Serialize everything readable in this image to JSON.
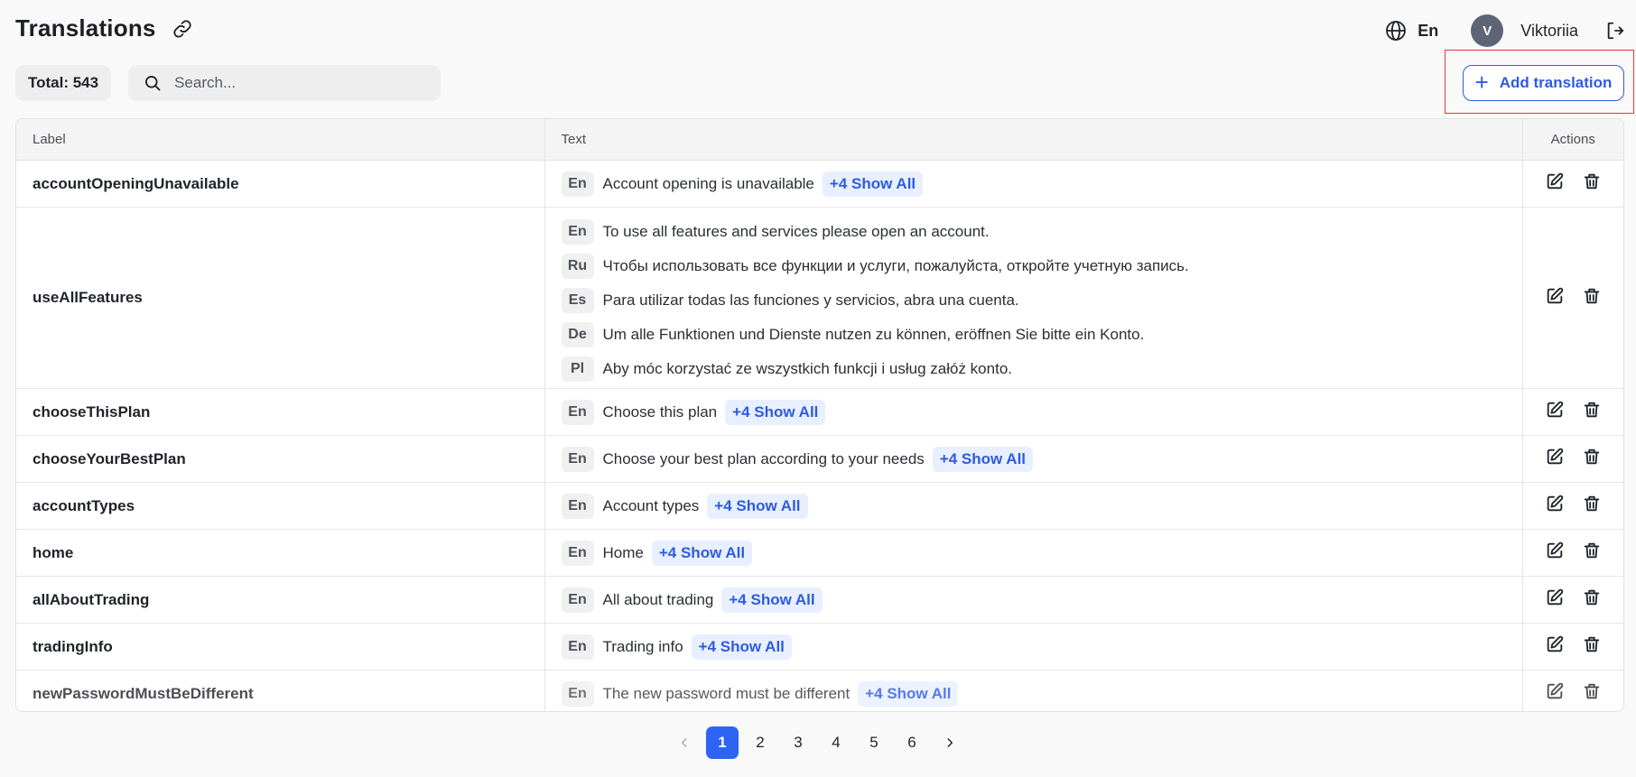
{
  "header": {
    "title": "Translations",
    "language": "En",
    "avatar_initial": "V",
    "username": "Viktoriia"
  },
  "toolbar": {
    "total_label": "Total: 543",
    "search_placeholder": "Search...",
    "add_label": "Add translation"
  },
  "table": {
    "columns": [
      "Label",
      "Text",
      "Actions"
    ],
    "rows": [
      {
        "label": "accountOpeningUnavailable",
        "lang": "En",
        "text": "Account opening is unavailable",
        "more": "+4 Show All"
      },
      {
        "label": "useAllFeatures",
        "translations": [
          {
            "lang": "En",
            "text": "To use all features and services please open an account."
          },
          {
            "lang": "Ru",
            "text": "Чтобы использовать все функции и услуги, пожалуйста, откройте учетную запись."
          },
          {
            "lang": "Es",
            "text": "Para utilizar todas las funciones y servicios, abra una cuenta."
          },
          {
            "lang": "De",
            "text": "Um alle Funktionen und Dienste nutzen zu können, eröffnen Sie bitte ein Konto."
          },
          {
            "lang": "Pl",
            "text": "Aby móc korzystać ze wszystkich funkcji i usług załóż konto."
          }
        ]
      },
      {
        "label": "chooseThisPlan",
        "lang": "En",
        "text": "Choose this plan",
        "more": "+4 Show All"
      },
      {
        "label": "chooseYourBestPlan",
        "lang": "En",
        "text": "Choose your best plan according to your needs",
        "more": "+4 Show All"
      },
      {
        "label": "accountTypes",
        "lang": "En",
        "text": "Account types",
        "more": "+4 Show All"
      },
      {
        "label": "home",
        "lang": "En",
        "text": "Home",
        "more": "+4 Show All"
      },
      {
        "label": "allAboutTrading",
        "lang": "En",
        "text": "All about trading",
        "more": "+4 Show All"
      },
      {
        "label": "tradingInfo",
        "lang": "En",
        "text": "Trading info",
        "more": "+4 Show All"
      },
      {
        "label": "newPasswordMustBeDifferent",
        "lang": "En",
        "text": "The new password must be different",
        "more": "+4 Show All"
      }
    ]
  },
  "pagination": {
    "pages": [
      "1",
      "2",
      "3",
      "4",
      "5",
      "6"
    ],
    "current": "1"
  },
  "icons": {
    "link": "link-icon",
    "globe": "globe-icon",
    "logout": "logout-icon",
    "search": "search-icon",
    "edit": "edit-icon",
    "delete": "trash-icon"
  },
  "colors": {
    "accent": "#2d5be3",
    "highlight_border": "#e53935"
  }
}
